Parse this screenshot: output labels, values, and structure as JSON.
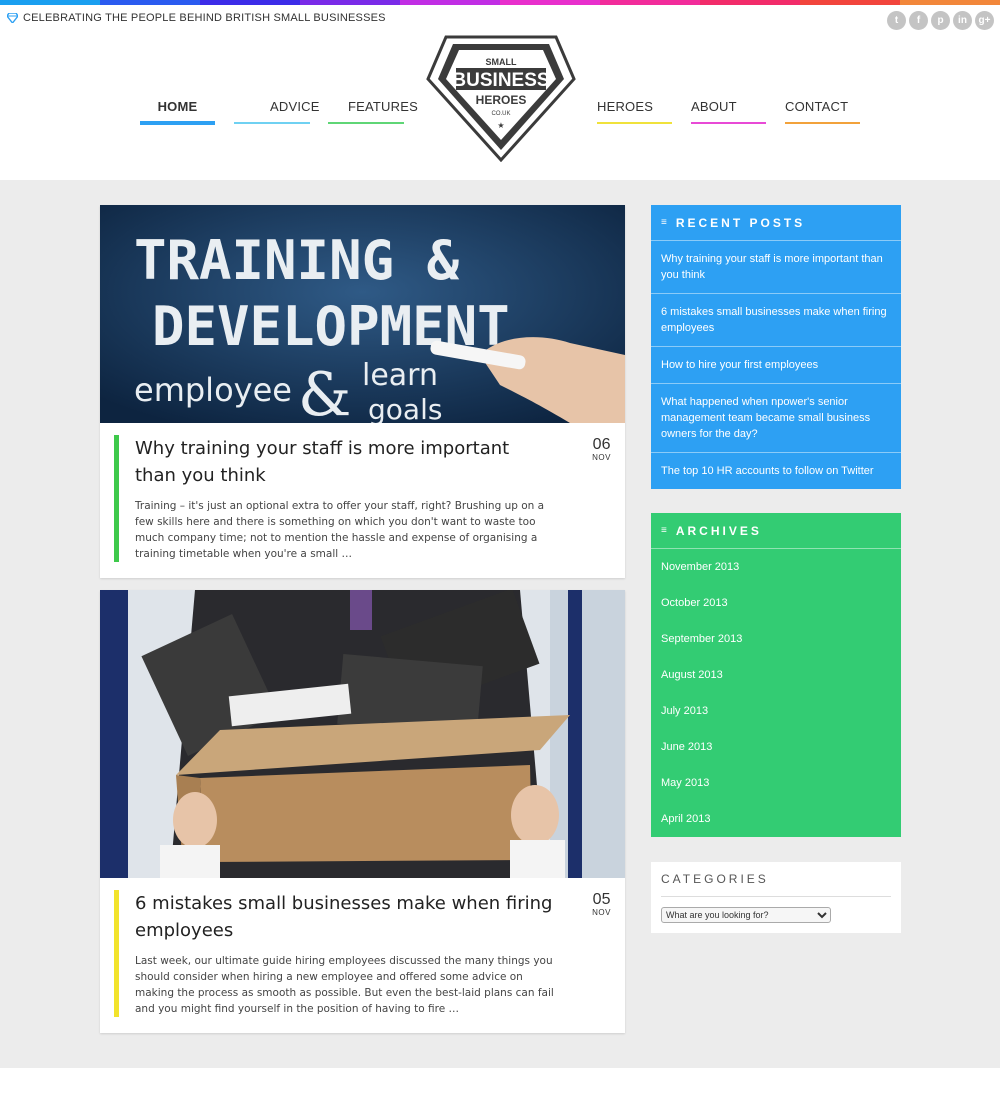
{
  "colors": {
    "rainbow": [
      "#1a9ff0",
      "#2b5bf0",
      "#3c2ce8",
      "#7a2be8",
      "#c12ee4",
      "#e82fcc",
      "#f22c9b",
      "#f22c6a",
      "#f2453c",
      "#f2873b"
    ],
    "home": "#2da0f3",
    "advice": "#6fd1f2",
    "features": "#5fd676",
    "heroes": "#f0e23b",
    "about": "#e84ad6",
    "contact": "#f2a23b",
    "recent_bg": "#2da0f3",
    "archives_bg": "#33cc73",
    "post1_accent": "#3ec94b",
    "post2_accent": "#f2e32c"
  },
  "header": {
    "tagline": "CELEBRATING THE PEOPLE BEHIND BRITISH SMALL BUSINESSES",
    "social": [
      {
        "name": "twitter-icon",
        "glyph": "t"
      },
      {
        "name": "facebook-icon",
        "glyph": "f"
      },
      {
        "name": "pinterest-icon",
        "glyph": "p"
      },
      {
        "name": "linkedin-icon",
        "glyph": "in"
      },
      {
        "name": "googleplus-icon",
        "glyph": "g+"
      }
    ],
    "logo": {
      "line1": "SMALL",
      "line2": "BUSINESS",
      "line3": "HEROES",
      "line4": "CO.UK",
      "star": "★"
    }
  },
  "nav": {
    "home": "HOME",
    "advice": "ADVICE",
    "features": "FEATURES",
    "heroes": "HEROES",
    "about": "ABOUT",
    "contact": "CONTACT"
  },
  "posts": [
    {
      "title": "Why training your staff is more important than you think",
      "excerpt": "Training – it's just an optional extra to offer your staff, right? Brushing up on a few skills here and there is something on which you don't want to waste too much company time; not to mention the hassle and expense of organising a training timetable when you're a small …",
      "day": "06",
      "month": "NOV",
      "image_text": {
        "line1": "TRAINING &",
        "line2": "DEVELOPMENT",
        "line3": "employee",
        "line4": "learn",
        "line5": "goals"
      }
    },
    {
      "title": "6 mistakes small businesses make when firing employees",
      "excerpt": "Last week, our ultimate guide hiring employees discussed the many things you should consider when hiring a new employee and offered some advice on making the process as smooth as possible. But even the best-laid plans can fail and you might find yourself in the position of having to fire …",
      "day": "05",
      "month": "NOV"
    }
  ],
  "sidebar": {
    "recent": {
      "title": "RECENT POSTS",
      "icon": "≡",
      "items": [
        "Why training your staff is more important than you think",
        "6 mistakes small businesses make when firing employees",
        "How to hire your first employees",
        "What happened when npower's senior management team became small business owners for the day?",
        "The top 10 HR accounts to follow on Twitter"
      ]
    },
    "archives": {
      "title": "ARCHIVES",
      "icon": "≡",
      "items": [
        "November 2013",
        "October 2013",
        "September 2013",
        "August 2013",
        "July 2013",
        "June 2013",
        "May 2013",
        "April 2013"
      ]
    },
    "categories": {
      "title": "CATEGORIES",
      "select_value": "What are you looking for?"
    }
  }
}
